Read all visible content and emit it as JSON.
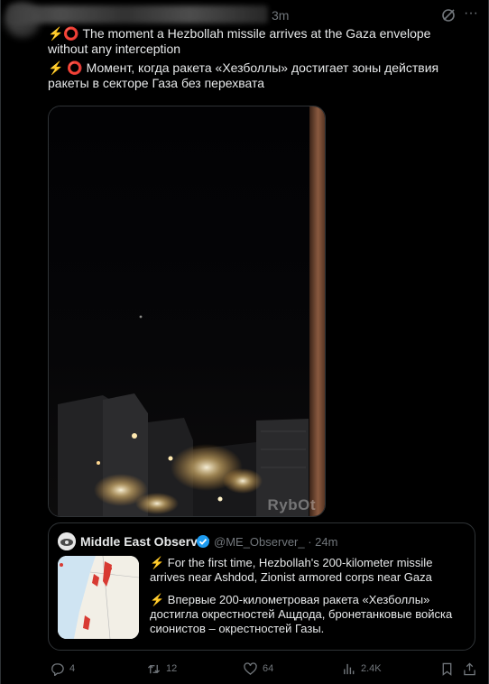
{
  "post": {
    "time": "3m",
    "text_en": "⚡⭕ The moment a Hezbollah missile arrives at the Gaza envelope without any interception",
    "text_ru": "⚡ ⭕ Момент, когда ракета «Хезболлы» достигает зоны действия ракеты в секторе Газа без перехвата",
    "media": {
      "watermark": "RybOt",
      "icon": "night-video-frame"
    }
  },
  "quote": {
    "author_name": "Middle East Observer",
    "handle_time": "@ME_Observer_ · 24m",
    "text_en": "⚡ For the first time, Hezbollah's 200-kilometer missile arrives near Ashdod, Zionist armored corps near Gaza",
    "text_ru": "⚡ Впервые 200-километровая ракета «Хезболлы» достигла окрестностей Ащдода, бронетанковые войска сионистов – окрестностей Газы.",
    "thumbnail": "map-icon"
  },
  "actions": {
    "replies": "4",
    "reposts": "12",
    "likes": "64",
    "views": "2.4K"
  },
  "colors": {
    "background": "#000000",
    "text": "#e7e9ea",
    "muted": "#71767b",
    "border": "#2f3336",
    "verified": "#1d9bf0"
  }
}
